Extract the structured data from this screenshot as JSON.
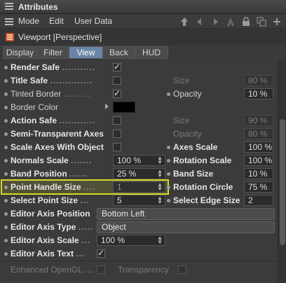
{
  "window": {
    "title": "Attributes"
  },
  "menu": {
    "items": [
      "Mode",
      "Edit",
      "User Data"
    ]
  },
  "object": {
    "title": "Viewport [Perspective]"
  },
  "tabs": [
    {
      "label": "Display",
      "active": false
    },
    {
      "label": "Filter",
      "active": false
    },
    {
      "label": "View",
      "active": true
    },
    {
      "label": "Back",
      "active": false
    },
    {
      "label": "HUD",
      "active": false
    }
  ],
  "rows": {
    "render_safe": {
      "label": "Render Safe",
      "checked": true
    },
    "title_safe": {
      "label": "Title Safe",
      "checked": false
    },
    "title_safe_size_label": "Size",
    "title_safe_size": "80 %",
    "tinted_border": {
      "label": "Tinted Border",
      "checked": true
    },
    "opacity_label": "Opacity",
    "opacity": "10 %",
    "border_color": {
      "label": "Border Color"
    },
    "action_safe": {
      "label": "Action Safe",
      "checked": false
    },
    "action_safe_size_label": "Size",
    "action_safe_size": "90 %",
    "semi_axes": {
      "label": "Semi-Transparent Axes",
      "checked": false
    },
    "semi_opacity_label": "Opacity",
    "semi_opacity": "80 %",
    "scale_axes": {
      "label": "Scale Axes With Object",
      "checked": false
    },
    "axes_scale_label": "Axes Scale",
    "axes_scale": "100 %",
    "normals_scale": {
      "label": "Normals Scale",
      "value": "100 %"
    },
    "rotation_scale_label": "Rotation Scale",
    "rotation_scale": "100 %",
    "band_position": {
      "label": "Band Position",
      "value": "25 %"
    },
    "band_size_label": "Band Size",
    "band_size": "10 %",
    "point_handle": {
      "label": "Point Handle Size",
      "value": "1"
    },
    "rotation_circle_label": "Rotation Circle",
    "rotation_circle": "75 %",
    "select_point": {
      "label": "Select Point Size",
      "value": "5"
    },
    "select_edge_label": "Select Edge Size",
    "select_edge": "2",
    "editor_axis_position": {
      "label": "Editor Axis Position",
      "value": "Bottom Left"
    },
    "editor_axis_type": {
      "label": "Editor Axis Type",
      "value": "Object"
    },
    "editor_axis_scale": {
      "label": "Editor Axis Scale",
      "value": "100 %"
    },
    "editor_axis_text": {
      "label": "Editor Axis Text",
      "checked": true
    },
    "enhanced_opengl": {
      "label": "Enhanced OpenGL",
      "checked": false
    },
    "transparency": {
      "label": "Transparency",
      "checked": false
    }
  },
  "colors": {
    "accent_tab": "#6a85a5",
    "highlight": "#d8d82a",
    "border_color_value": "#000000"
  }
}
